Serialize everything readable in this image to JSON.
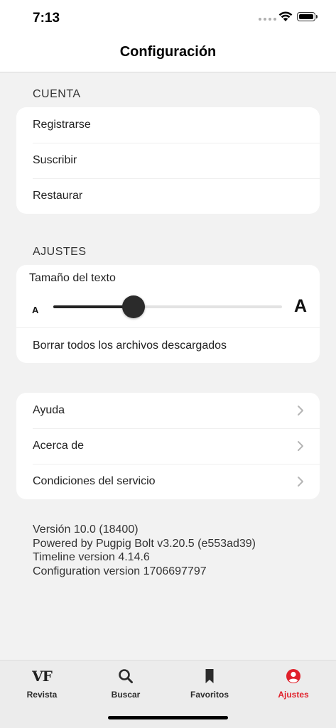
{
  "status": {
    "time": "7:13"
  },
  "header": {
    "title": "Configuración"
  },
  "account": {
    "section_label": "CUENTA",
    "items": [
      {
        "label": "Registrarse"
      },
      {
        "label": "Suscribir"
      },
      {
        "label": "Restaurar"
      }
    ]
  },
  "settings": {
    "section_label": "AJUSTES",
    "text_size": {
      "title": "Tamaño del texto",
      "small_label": "A",
      "large_label": "A",
      "value_fraction": 0.35
    },
    "clear_downloads": "Borrar todos los archivos descargados"
  },
  "info": {
    "items": [
      {
        "label": "Ayuda"
      },
      {
        "label": "Acerca de"
      },
      {
        "label": "Condiciones del servicio"
      }
    ]
  },
  "version": {
    "lines": [
      "Versión 10.0 (18400)",
      "Powered by Pugpig Bolt v3.20.5 (e553ad39)",
      "Timeline version 4.14.6",
      "Configuration version 1706697797"
    ]
  },
  "tabbar": {
    "tabs": [
      {
        "label": "Revista",
        "icon": "vf-logo-icon",
        "logo_text": "VF"
      },
      {
        "label": "Buscar",
        "icon": "search-icon"
      },
      {
        "label": "Favoritos",
        "icon": "bookmark-icon"
      },
      {
        "label": "Ajustes",
        "icon": "user-circle-icon",
        "active": true
      }
    ],
    "active_color": "#e0202a"
  }
}
